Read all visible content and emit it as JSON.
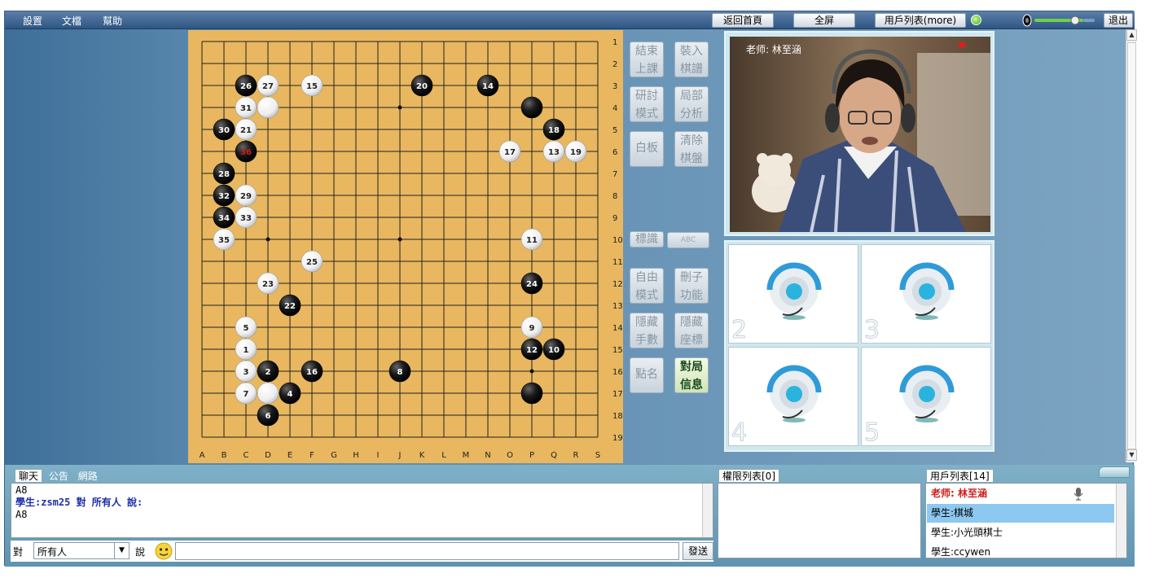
{
  "menu": [
    "設置",
    "文檔",
    "幫助"
  ],
  "top_buttons": {
    "home": "返回首頁",
    "fullscreen": "全屏",
    "userlist": "用戶列表(more)",
    "exit": "退出"
  },
  "tools": {
    "end_class": [
      "結束",
      "上課"
    ],
    "load_record": [
      "裝入",
      "棋譜"
    ],
    "study_mode": [
      "研討",
      "模式"
    ],
    "local_analysis": [
      "局部",
      "分析"
    ],
    "whiteboard": "白板",
    "clear_board": [
      "清除",
      "棋盤"
    ],
    "mark": "標識",
    "mark_abc": "ABC",
    "free_mode": [
      "自由",
      "模式"
    ],
    "remove_stone": [
      "刪子",
      "功能"
    ],
    "hide_moves": [
      "隱藏",
      "手數"
    ],
    "hide_coords": [
      "隱藏",
      "座標"
    ],
    "roll_call": "點名",
    "game_info": [
      "對局",
      "信息"
    ]
  },
  "board": {
    "cols": [
      "A",
      "B",
      "C",
      "D",
      "E",
      "F",
      "G",
      "H",
      "I",
      "J",
      "K",
      "L",
      "M",
      "N",
      "O",
      "P",
      "Q",
      "R",
      "S"
    ],
    "rows": [
      "1",
      "2",
      "3",
      "4",
      "5",
      "6",
      "7",
      "8",
      "9",
      "10",
      "11",
      "12",
      "13",
      "14",
      "15",
      "16",
      "17",
      "18",
      "19"
    ],
    "stones": [
      {
        "c": 3,
        "r": 3,
        "color": "black",
        "n": "26"
      },
      {
        "c": 4,
        "r": 3,
        "color": "white",
        "n": "27"
      },
      {
        "c": 6,
        "r": 3,
        "color": "white",
        "n": "15"
      },
      {
        "c": 11,
        "r": 3,
        "color": "black",
        "n": "20"
      },
      {
        "c": 14,
        "r": 3,
        "color": "black",
        "n": "14"
      },
      {
        "c": 3,
        "r": 4,
        "color": "white",
        "n": "31"
      },
      {
        "c": 4,
        "r": 4,
        "color": "white",
        "n": ""
      },
      {
        "c": 16,
        "r": 4,
        "color": "black",
        "n": ""
      },
      {
        "c": 2,
        "r": 5,
        "color": "black",
        "n": "30"
      },
      {
        "c": 3,
        "r": 5,
        "color": "white",
        "n": "21"
      },
      {
        "c": 17,
        "r": 5,
        "color": "black",
        "n": "18"
      },
      {
        "c": 3,
        "r": 6,
        "color": "black",
        "n": "36",
        "last": true
      },
      {
        "c": 15,
        "r": 6,
        "color": "white",
        "n": "17"
      },
      {
        "c": 17,
        "r": 6,
        "color": "white",
        "n": "13"
      },
      {
        "c": 18,
        "r": 6,
        "color": "white",
        "n": "19"
      },
      {
        "c": 2,
        "r": 7,
        "color": "black",
        "n": "28"
      },
      {
        "c": 2,
        "r": 8,
        "color": "black",
        "n": "32"
      },
      {
        "c": 3,
        "r": 8,
        "color": "white",
        "n": "29"
      },
      {
        "c": 2,
        "r": 9,
        "color": "black",
        "n": "34"
      },
      {
        "c": 3,
        "r": 9,
        "color": "white",
        "n": "33"
      },
      {
        "c": 2,
        "r": 10,
        "color": "white",
        "n": "35"
      },
      {
        "c": 16,
        "r": 10,
        "color": "white",
        "n": "11"
      },
      {
        "c": 6,
        "r": 11,
        "color": "white",
        "n": "25"
      },
      {
        "c": 4,
        "r": 12,
        "color": "white",
        "n": "23"
      },
      {
        "c": 16,
        "r": 12,
        "color": "black",
        "n": "24"
      },
      {
        "c": 5,
        "r": 13,
        "color": "black",
        "n": "22"
      },
      {
        "c": 3,
        "r": 14,
        "color": "white",
        "n": "5"
      },
      {
        "c": 16,
        "r": 14,
        "color": "white",
        "n": "9"
      },
      {
        "c": 3,
        "r": 15,
        "color": "white",
        "n": "1"
      },
      {
        "c": 16,
        "r": 15,
        "color": "black",
        "n": "12"
      },
      {
        "c": 17,
        "r": 15,
        "color": "black",
        "n": "10"
      },
      {
        "c": 3,
        "r": 16,
        "color": "white",
        "n": "3"
      },
      {
        "c": 4,
        "r": 16,
        "color": "black",
        "n": "2"
      },
      {
        "c": 6,
        "r": 16,
        "color": "black",
        "n": "16"
      },
      {
        "c": 10,
        "r": 16,
        "color": "black",
        "n": "8"
      },
      {
        "c": 3,
        "r": 17,
        "color": "white",
        "n": "7"
      },
      {
        "c": 4,
        "r": 17,
        "color": "white",
        "n": ""
      },
      {
        "c": 5,
        "r": 17,
        "color": "black",
        "n": "4"
      },
      {
        "c": 16,
        "r": 17,
        "color": "black",
        "n": ""
      },
      {
        "c": 4,
        "r": 18,
        "color": "black",
        "n": "6"
      }
    ]
  },
  "video": {
    "teacher_label": "老师: 林至涵"
  },
  "seats": [
    "2",
    "3",
    "4",
    "5"
  ],
  "chat": {
    "tabs": [
      "聊天",
      "公告",
      "網路"
    ],
    "lines": [
      {
        "text": "A8",
        "style": "normal"
      },
      {
        "text": "學生:zsm25 對 所有人 說:",
        "style": "blue"
      },
      {
        "text": "A8",
        "style": "normal"
      }
    ],
    "to_label": "對",
    "recipient": "所有人",
    "say_label": "說",
    "send": "發送"
  },
  "perm_title": "權限列表[0]",
  "users_title": "用戶列表[14]",
  "users": [
    {
      "label": "老师: 林至涵",
      "role": "teacher"
    },
    {
      "label": "學生:棋城",
      "role": "selected"
    },
    {
      "label": "學生:小光頭棋士",
      "role": "student"
    },
    {
      "label": "學生:ccywen",
      "role": "student"
    }
  ],
  "colors": {
    "board": "#e8b75f",
    "accent": "#3e6f99",
    "selected_row": "#8cc8f0",
    "teacher_red": "#d01a1a"
  }
}
